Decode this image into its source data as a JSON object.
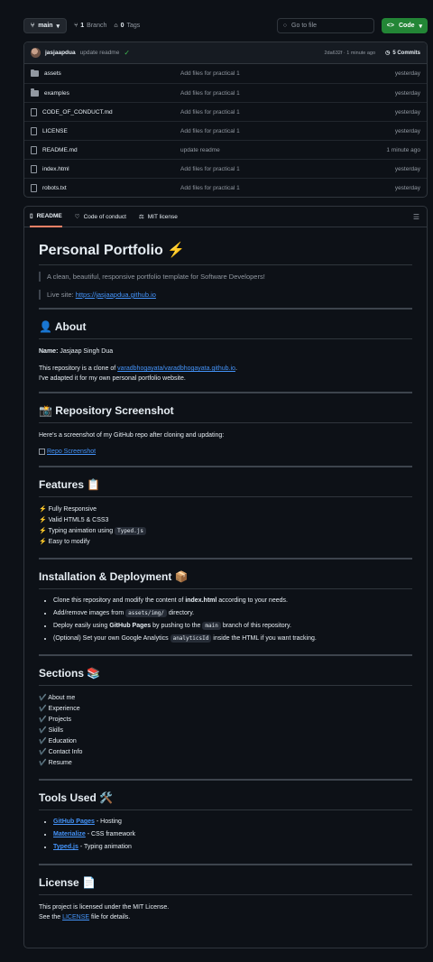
{
  "topbar": {
    "branch": "main",
    "branches_count": "1",
    "branches_label": "Branch",
    "tags_count": "0",
    "tags_label": "Tags",
    "search_placeholder": "Go to file",
    "code_label": "Code"
  },
  "commit": {
    "user": "jasjaapdua",
    "message": "update readme",
    "sha_time": "2da632f · 1 minute ago",
    "commits_label": "5 Commits"
  },
  "files": [
    {
      "name": "assets",
      "type": "folder",
      "message": "Add files for practical 1",
      "age": "yesterday"
    },
    {
      "name": "examples",
      "type": "folder",
      "message": "Add files for practical 1",
      "age": "yesterday"
    },
    {
      "name": "CODE_OF_CONDUCT.md",
      "type": "file",
      "message": "Add files for practical 1",
      "age": "yesterday"
    },
    {
      "name": "LICENSE",
      "type": "file",
      "message": "Add files for practical 1",
      "age": "yesterday"
    },
    {
      "name": "README.md",
      "type": "file",
      "message": "update readme",
      "age": "1 minute ago"
    },
    {
      "name": "index.html",
      "type": "file",
      "message": "Add files for practical 1",
      "age": "yesterday"
    },
    {
      "name": "robots.txt",
      "type": "file",
      "message": "Add files for practical 1",
      "age": "yesterday"
    }
  ],
  "tabs": [
    "README",
    "Code of conduct",
    "MIT license"
  ],
  "readme": {
    "title": "Personal Portfolio ⚡",
    "tagline": "A clean, beautiful, responsive portfolio template for Software Developers!",
    "live_label": "Live site:",
    "live_link": "https://jasjaapdua.github.io",
    "about_h": "👤 About",
    "name_label": "Name:",
    "name_value": "Jasjaap Singh Dua",
    "clone_pre": "This repository is a clone of",
    "clone_link": "varadbhogayata/varadbhogayata.github.io",
    "clone_post": ".",
    "adapted": "I've adapted it for my own personal portfolio website.",
    "screenshot_h": "📸 Repository Screenshot",
    "screenshot_text": "Here's a screenshot of my GitHub repo after cloning and updating:",
    "screenshot_alt": "Repo Screenshot",
    "features_h": "Features 📋",
    "features": [
      {
        "pre": "⚡ Fully Responsive",
        "code": "",
        "post": ""
      },
      {
        "pre": "⚡ Valid HTML5 & CSS3",
        "code": "",
        "post": ""
      },
      {
        "pre": "⚡ Typing animation using",
        "code": "Typed.js",
        "post": ""
      },
      {
        "pre": "⚡ Easy to modify",
        "code": "",
        "post": ""
      }
    ],
    "install_h": "Installation & Deployment 📦",
    "install": [
      {
        "a": "Clone this repository and modify the content of",
        "b": "index.html",
        "c": "according to your needs.",
        "kind": "bold"
      },
      {
        "a": "Add/remove images from",
        "b": "assets/img/",
        "c": "directory.",
        "kind": "code"
      },
      {
        "a": "Deploy easily using",
        "b": "GitHub Pages",
        "c": "by pushing to the",
        "d": "main",
        "e": "branch of this repository.",
        "kind": "mixed"
      },
      {
        "a": "(Optional) Set your own Google Analytics",
        "b": "analyticsId",
        "c": "inside the HTML if you want tracking.",
        "kind": "code"
      }
    ],
    "sections_h": "Sections 📚",
    "sections": [
      "✔️ About me",
      "✔️ Experience",
      "✔️ Projects",
      "✔️ Skills",
      "✔️ Education",
      "✔️ Contact Info",
      "✔️ Resume"
    ],
    "tools_h": "Tools Used 🛠️",
    "tools": [
      {
        "link": "GitHub Pages",
        "desc": "- Hosting"
      },
      {
        "link": "Materialize",
        "desc": "- CSS framework"
      },
      {
        "link": "Typed.js",
        "desc": "- Typing animation"
      }
    ],
    "license_h": "License 📄",
    "license_text": "This project is licensed under the MIT License.",
    "license_see_pre": "See the",
    "license_see_link": "LICENSE",
    "license_see_post": "file for details."
  }
}
